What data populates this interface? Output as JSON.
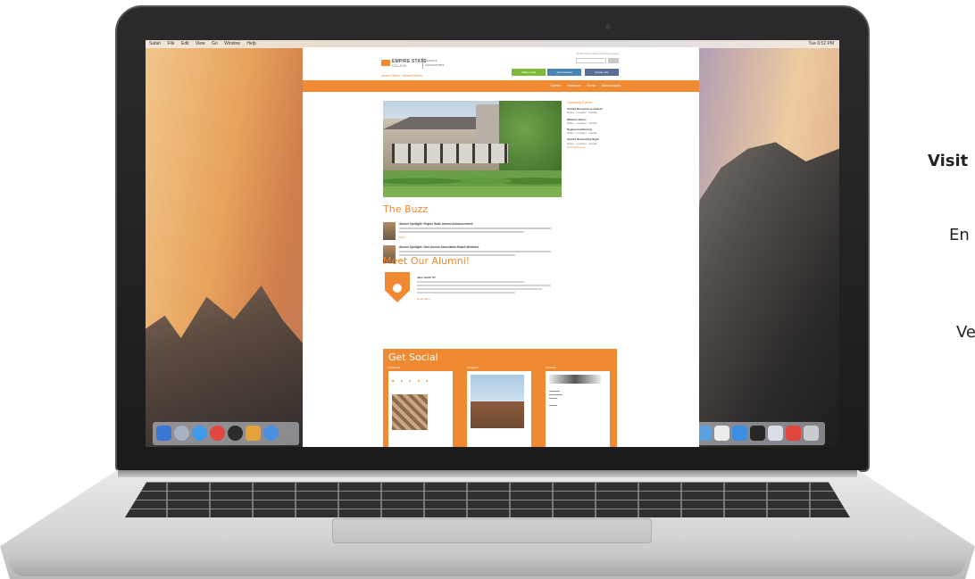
{
  "side_text": {
    "visit": "Visit",
    "en": "En",
    "ve": "Ve"
  },
  "macos": {
    "menu_items": [
      "Safari",
      "File",
      "Edit",
      "View",
      "Go",
      "Window",
      "Help"
    ],
    "menu_right": "Tue 6:52 PM"
  },
  "site": {
    "toplinks": "SUNY Home   Alumni   Giving   Contact",
    "logo_text": "EMPIRE STATE",
    "logo_sub": "COLLEGE",
    "dept_line1": "Alumni &",
    "dept_line2": "Advancement",
    "tagline": "Alumni Office · Alumni Events",
    "header_buttons": [
      "Make a Gift",
      "Get Involved",
      "Update Info"
    ],
    "nav_items": [
      "Connect",
      "Newsroom",
      "Events",
      "Alumni Awards"
    ],
    "buzz_title": "The Buzz",
    "buzz": [
      {
        "title": "Alumni Spotlight: Empire State Alumni Announcement",
        "more": "More"
      },
      {
        "title": "Alumni Spotlight: New Alumni Association Board Members",
        "more": "More"
      }
    ],
    "alumni_title": "Meet Our Alumni!",
    "alumni_name": "Jane Smith '07",
    "alumni_more": "Read More",
    "sidebar_title": "Upcoming Events",
    "sidebar_headings": [
      "Alumni Reception & Awards",
      "Webinar Series",
      "Regional Gathering",
      "Alumni Networking Night"
    ],
    "sidebar_link": "View All Events",
    "social_title": "Get Social",
    "social_cols": [
      "Facebook",
      "Instagram",
      "LinkedIn"
    ]
  }
}
